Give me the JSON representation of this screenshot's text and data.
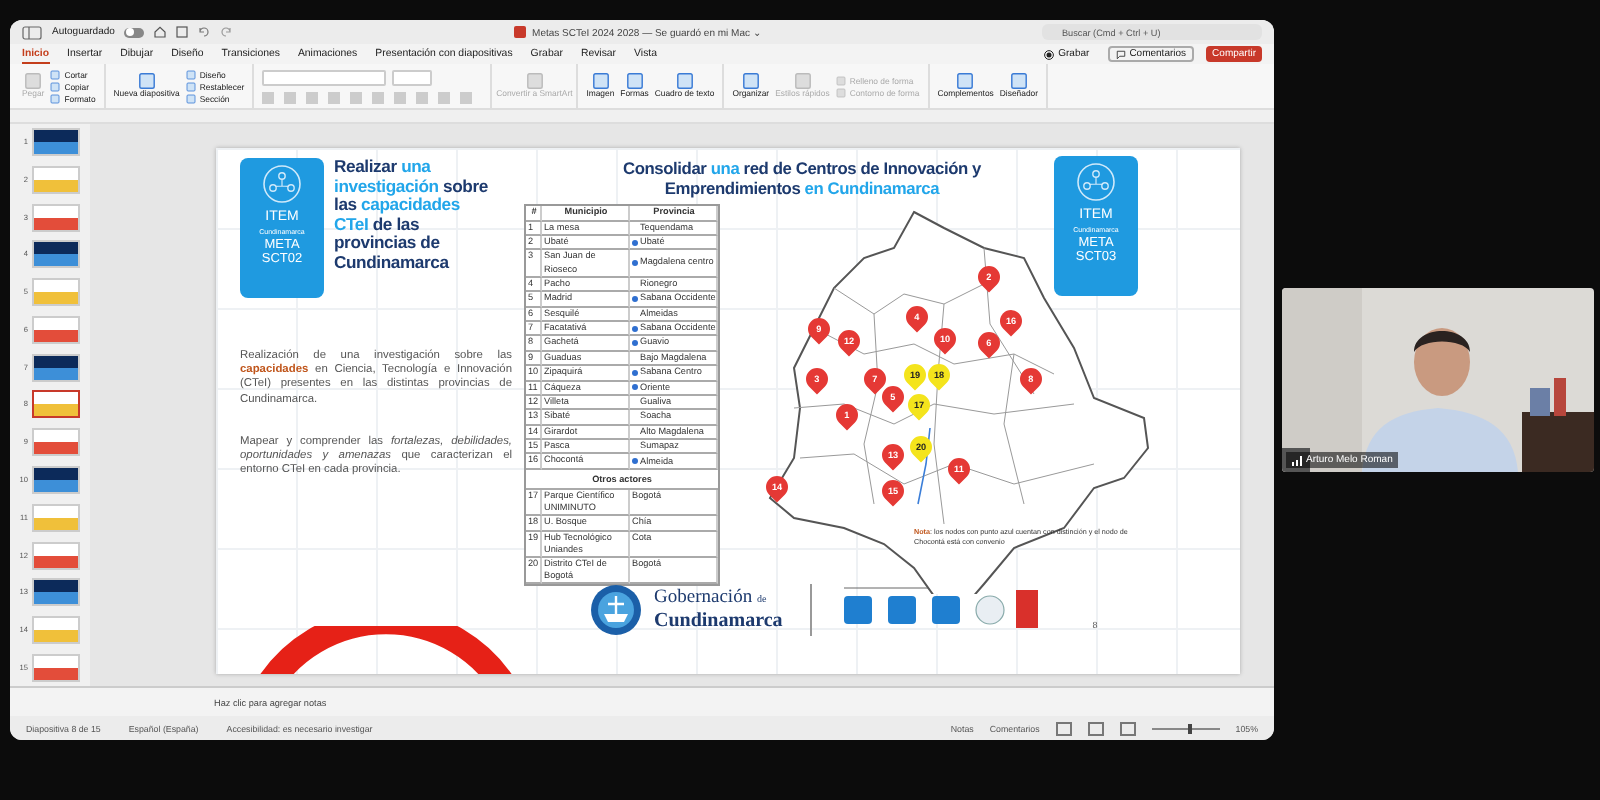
{
  "title_bar": {
    "autosave_label": "Autoguardado",
    "autosave_on": false,
    "title": "Metas SCTeI 2024 2028 — Se guardó en mi Mac ⌄",
    "search_placeholder": "Buscar (Cmd + Ctrl + U)"
  },
  "ribbon_tabs": [
    {
      "label": "Inicio",
      "selected": true
    },
    {
      "label": "Insertar",
      "selected": false
    },
    {
      "label": "Dibujar",
      "selected": false
    },
    {
      "label": "Diseño",
      "selected": false
    },
    {
      "label": "Transiciones",
      "selected": false
    },
    {
      "label": "Animaciones",
      "selected": false
    },
    {
      "label": "Presentación con diapositivas",
      "selected": false
    },
    {
      "label": "Grabar",
      "selected": false
    },
    {
      "label": "Revisar",
      "selected": false
    },
    {
      "label": "Vista",
      "selected": false
    }
  ],
  "ribbon_actions": [
    {
      "label": "Grabar",
      "kind": "record"
    },
    {
      "label": "Comentarios",
      "kind": "comments"
    },
    {
      "label": "Compartir",
      "kind": "share"
    }
  ],
  "ribbon_groups": [
    {
      "items": [
        {
          "label": "Pegar",
          "kind": "large",
          "disabled": true
        },
        {
          "label": "Cortar",
          "kind": "small",
          "disabled": false
        },
        {
          "label": "Copiar",
          "kind": "small",
          "disabled": false
        },
        {
          "label": "Formato",
          "kind": "small",
          "disabled": false
        }
      ]
    },
    {
      "items": [
        {
          "label": "Nueva diapositiva",
          "kind": "large",
          "disabled": false
        },
        {
          "label": "Diseño",
          "kind": "small",
          "disabled": false
        },
        {
          "label": "Restablecer",
          "kind": "small",
          "disabled": false
        },
        {
          "label": "Sección",
          "kind": "small",
          "disabled": false
        }
      ]
    },
    {
      "items": [
        {
          "kind": "font",
          "disabled": true
        }
      ]
    },
    {
      "items": [
        {
          "label": "Convertir a SmartArt",
          "kind": "large",
          "disabled": true
        }
      ]
    },
    {
      "items": [
        {
          "label": "Imagen",
          "kind": "large",
          "disabled": false
        },
        {
          "label": "Formas",
          "kind": "large",
          "disabled": false
        },
        {
          "label": "Cuadro de texto",
          "kind": "large",
          "disabled": false
        }
      ]
    },
    {
      "items": [
        {
          "label": "Organizar",
          "kind": "large",
          "disabled": false
        },
        {
          "label": "Estilos rápidos",
          "kind": "large",
          "disabled": true
        },
        {
          "label": "Relleno de forma",
          "kind": "small",
          "disabled": true
        },
        {
          "label": "Contorno de forma",
          "kind": "small",
          "disabled": true
        }
      ]
    },
    {
      "items": [
        {
          "label": "Complementos",
          "kind": "large",
          "disabled": false
        },
        {
          "label": "Diseñador",
          "kind": "large",
          "disabled": false
        }
      ]
    }
  ],
  "thumbnails": [
    {
      "number": "1",
      "selected": false
    },
    {
      "number": "2",
      "selected": false
    },
    {
      "number": "3",
      "selected": false
    },
    {
      "number": "4",
      "selected": false
    },
    {
      "number": "5",
      "selected": false
    },
    {
      "number": "6",
      "selected": false
    },
    {
      "number": "7",
      "selected": false
    },
    {
      "number": "8",
      "selected": true
    },
    {
      "number": "9",
      "selected": false
    },
    {
      "number": "10",
      "selected": false
    },
    {
      "number": "11",
      "selected": false
    },
    {
      "number": "12",
      "selected": false
    },
    {
      "number": "13",
      "selected": false
    },
    {
      "number": "14",
      "selected": false
    },
    {
      "number": "15",
      "selected": false
    }
  ],
  "slide": {
    "left_card": {
      "item": "ITEM",
      "region": "Cundinamarca",
      "meta": "META",
      "code": "SCT02"
    },
    "heading": "Realizar **una investigación** sobre las **capacidades CTeI** de las provincias de Cundinamarca",
    "paragraphs": [
      "Realización de una investigación sobre las **capacidades** en Ciencia, Tecnología e Innovación (CTeI) presentes en las distintas provincias de Cundinamarca.",
      "Mapear y comprender las *fortalezas, debilidades, oportunidades y amenazas* que caracterizan el entorno CTeI en cada provincia."
    ],
    "title": "Consolidar **una** red de Centros de Innovación y Emprendimientos **en Cundinamarca**",
    "table": {
      "columns": [
        "#",
        "Municipio",
        "Provincia"
      ],
      "rows": [
        {
          "num": "1",
          "municipality": "La mesa",
          "province": "Tequendama",
          "blue_dot": false
        },
        {
          "num": "2",
          "municipality": "Ubaté",
          "province": "Ubaté",
          "blue_dot": true
        },
        {
          "num": "3",
          "municipality": "San Juan de Rioseco",
          "province": "Magdalena centro",
          "blue_dot": true
        },
        {
          "num": "4",
          "municipality": "Pacho",
          "province": "Rionegro",
          "blue_dot": false
        },
        {
          "num": "5",
          "municipality": "Madrid",
          "province": "Sabana Occidente",
          "blue_dot": true
        },
        {
          "num": "6",
          "municipality": "Sesquilé",
          "province": "Almeidas",
          "blue_dot": false
        },
        {
          "num": "7",
          "municipality": "Facatativá",
          "province": "Sabana Occidente",
          "blue_dot": true
        },
        {
          "num": "8",
          "municipality": "Gachetá",
          "province": "Guavio",
          "blue_dot": true
        },
        {
          "num": "9",
          "municipality": "Guaduas",
          "province": "Bajo Magdalena",
          "blue_dot": false
        },
        {
          "num": "10",
          "municipality": "Zipaquirá",
          "province": "Sabana Centro",
          "blue_dot": true
        },
        {
          "num": "11",
          "municipality": "Cáqueza",
          "province": "Oriente",
          "blue_dot": true
        },
        {
          "num": "12",
          "municipality": "Villeta",
          "province": "Gualiva",
          "blue_dot": false
        },
        {
          "num": "13",
          "municipality": "Sibaté",
          "province": "Soacha",
          "blue_dot": false
        },
        {
          "num": "14",
          "municipality": "Girardot",
          "province": "Alto Magdalena",
          "blue_dot": false
        },
        {
          "num": "15",
          "municipality": "Pasca",
          "province": "Sumapaz",
          "blue_dot": false
        },
        {
          "num": "16",
          "municipality": "Chocontá",
          "province": "Almeida",
          "blue_dot": true
        }
      ],
      "section": "Otros actores",
      "other_rows": [
        {
          "num": "17",
          "name": "Parque Científico UNIMINUTO",
          "place": "Bogotá"
        },
        {
          "num": "18",
          "name": "U. Bosque",
          "place": "Chía"
        },
        {
          "num": "19",
          "name": "Hub Tecnológico Uniandes",
          "place": "Cota"
        },
        {
          "num": "20",
          "name": "Distrito CTeI de Bogotá",
          "place": "Bogotá"
        }
      ]
    },
    "pins": [
      {
        "label": "1",
        "color": "#e53935"
      },
      {
        "label": "2",
        "color": "#e53935"
      },
      {
        "label": "3",
        "color": "#e53935"
      },
      {
        "label": "4",
        "color": "#e53935"
      },
      {
        "label": "5",
        "color": "#e53935"
      },
      {
        "label": "6",
        "color": "#e53935"
      },
      {
        "label": "7",
        "color": "#e53935"
      },
      {
        "label": "8",
        "color": "#e53935"
      },
      {
        "label": "9",
        "color": "#e53935"
      },
      {
        "label": "10",
        "color": "#e53935"
      },
      {
        "label": "11",
        "color": "#e53935"
      },
      {
        "label": "12",
        "color": "#e53935"
      },
      {
        "label": "13",
        "color": "#e53935"
      },
      {
        "label": "14",
        "color": "#e53935"
      },
      {
        "label": "15",
        "color": "#e53935"
      },
      {
        "label": "16",
        "color": "#e53935"
      },
      {
        "label": "19",
        "color": "#f4e41c"
      },
      {
        "label": "18",
        "color": "#f4e41c"
      },
      {
        "label": "17",
        "color": "#f4e41c"
      },
      {
        "label": "20",
        "color": "#f4e41c"
      }
    ],
    "right_card": {
      "item": "ITEM",
      "region": "Cundinamarca",
      "meta": "META",
      "code": "SCT03"
    },
    "note": "**Nota**: los nodos con punto azul cuentan con distinción y el nodo de Chocontá está con convenio",
    "footer": {
      "logo_line1": "Gobernación",
      "logo_de": "de",
      "logo_line2": "Cundinamarca"
    },
    "page_number": "8"
  },
  "notes_placeholder": "Haz clic para agregar notas",
  "status_bar": {
    "slide": "Diapositiva 8 de 15",
    "language": "Español (España)",
    "accessibility": "Accesibilidad: es necesario investigar",
    "notes": "Notas",
    "comments": "Comentarios",
    "zoom": "105%",
    "zoom_slider": {
      "level": 0.55
    }
  },
  "video": {
    "name": "Arturo Melo Roman"
  }
}
